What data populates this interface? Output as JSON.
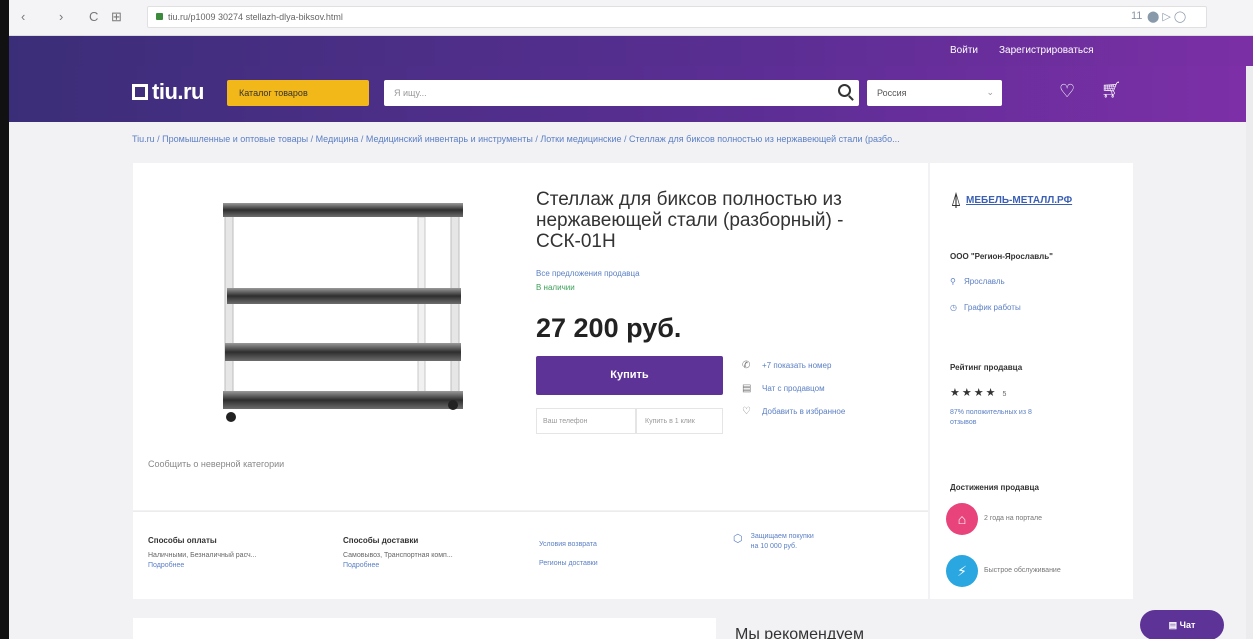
{
  "browser": {
    "back": "‹",
    "forward": "›",
    "reload": "C",
    "apps": "⊞",
    "url": "tiu.ru/p1009 30274 stellazh-dlya-biksov.html",
    "ext_counter": "11",
    "ext_icons": "⬤ ▷ ◯"
  },
  "top_strip": {
    "login": "Войти",
    "register": "Зарегистрироваться"
  },
  "header": {
    "logo": "tiu.ru",
    "catalog_label": "Каталог товаров",
    "search_placeholder": "Я ищу...",
    "region": "Россия"
  },
  "breadcrumb": "Tiu.ru / Промышленные и оптовые товары / Медицина / Медицинский инвентарь и инструменты / Лотки медицинские / Стеллаж для биксов полностью из нержавеющей стали (разбо...",
  "product": {
    "title": "Стеллаж для биксов полностью из нержавеющей стали (разборный) - ССК-01Н",
    "all_offers": "Все предложения продавца",
    "stock": "В наличии",
    "price": "27 200 руб.",
    "buy": "Купить",
    "phone_placeholder": "Ваш телефон",
    "one_click": "Купить в 1 клик",
    "show_phone": "+7 показать номер",
    "chat_seller": "Чат с продавцом",
    "add_favorite": "Добавить в избранное",
    "report_category": "Сообщить о неверной категории"
  },
  "info": {
    "payment_title": "Способы оплаты",
    "payment_text": "Наличными, Безналичный расч...",
    "payment_more": "Подробнее",
    "delivery_title": "Способы доставки",
    "delivery_text": "Самовывоз, Транспортная комп...",
    "delivery_more": "Подробнее",
    "return_link": "Условия возврата",
    "regions_link": "Регионы доставки",
    "protect": "Защищаем покупки\nна 10 000 руб."
  },
  "seller": {
    "logo_text": "МЕБЕЛЬ-МЕТАЛЛ.РФ",
    "company": "ООО \"Регион-Ярославль\"",
    "city": "Ярославль",
    "schedule": "График работы",
    "rating_title": "Рейтинг продавца",
    "stars": "★★★★",
    "rating_value": "5",
    "positive": "87% положительных из 8 отзывов",
    "achievements_title": "Достижения продавца",
    "ach1": "2 года на портале",
    "ach2": "Быстрое обслуживание",
    "ach1_color": "#e8437b",
    "ach2_color": "#2aa6e0"
  },
  "recommend_title": "Мы рекомендуем",
  "chat_label": "Чат"
}
